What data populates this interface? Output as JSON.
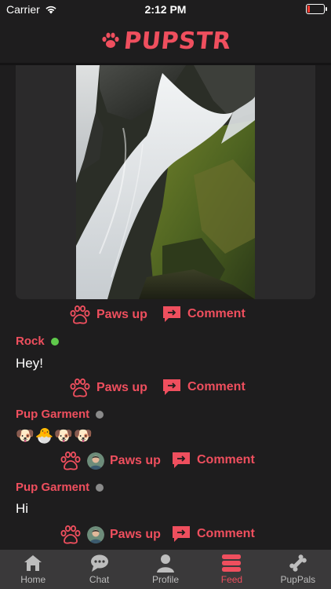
{
  "status_bar": {
    "carrier": "Carrier",
    "time": "2:12 PM",
    "battery_level": 0.15,
    "battery_color": "#ff3b30"
  },
  "header": {
    "logo_text": "PUPSTR",
    "logo_icon": "paw-icon",
    "brand_color": "#ef4f5e"
  },
  "feed": {
    "photo_post": {
      "image": "waterfall-photo",
      "actions": {
        "paws_up": "Paws up",
        "comment": "Comment"
      }
    },
    "messages": [
      {
        "author": "Rock",
        "online": true,
        "text": "Hey!",
        "actions": {
          "paws_up": "Paws up",
          "comment": "Comment"
        }
      },
      {
        "author": "Pup Garment",
        "online": false,
        "emoji": [
          "🐶",
          "🐣",
          "🐶",
          "🐶"
        ],
        "actions": {
          "paws_up": "Paws up",
          "comment": "Comment"
        }
      },
      {
        "author": "Pup Garment",
        "online": false,
        "text": "Hi",
        "actions": {
          "paws_up": "Paws up",
          "comment": "Comment"
        }
      }
    ]
  },
  "tab_bar": {
    "active_tab": "Feed",
    "tabs": [
      {
        "label": "Home",
        "icon": "home-icon"
      },
      {
        "label": "Chat",
        "icon": "chat-bubble-icon"
      },
      {
        "label": "Profile",
        "icon": "profile-icon"
      },
      {
        "label": "Feed",
        "icon": "feed-icon"
      },
      {
        "label": "PupPals",
        "icon": "bone-icon"
      }
    ]
  },
  "colors": {
    "accent": "#ef4f5e",
    "online": "#5fc94b",
    "offline": "#8a8a8a",
    "background": "#1e1d1e",
    "tab_bar": "#3a393a"
  }
}
